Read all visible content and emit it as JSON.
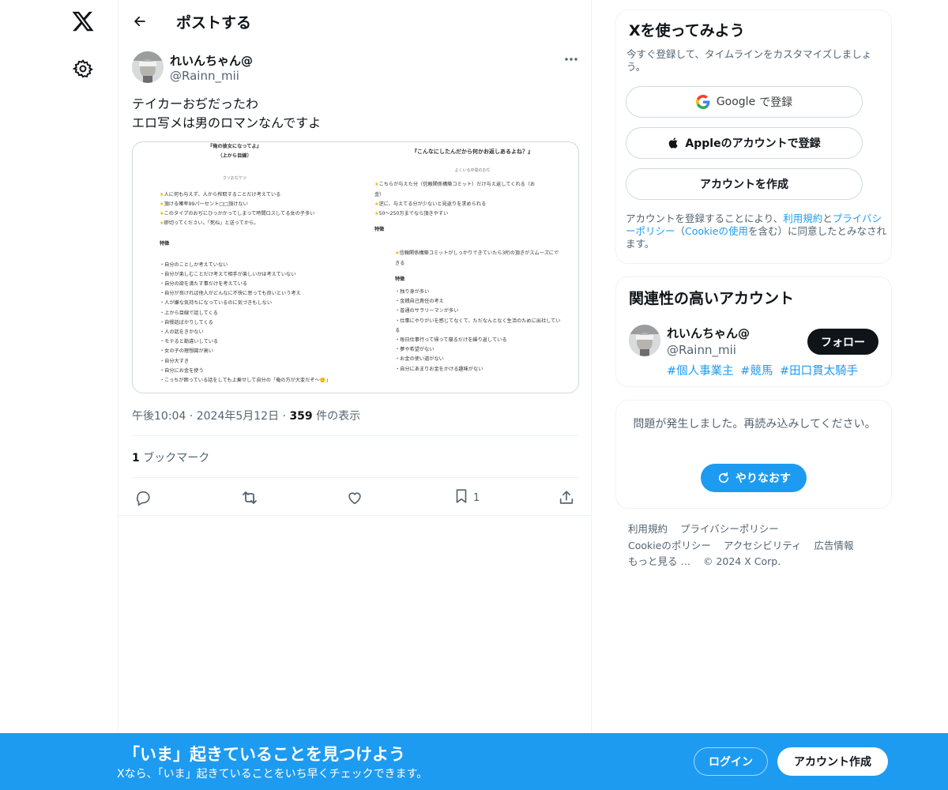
{
  "nav": {
    "logo_icon": "x-logo-icon",
    "settings_icon": "gear-icon"
  },
  "header": {
    "title": "ポストする",
    "back_icon": "arrow-left-icon"
  },
  "tweet": {
    "author_name": "れいんちゃん@",
    "author_handle": "@Rainn_mii",
    "text_lines": [
      "テイカーおぢだったわ",
      "エロ写メは男のロマンなんですよ"
    ],
    "time": "午後10:04",
    "date": "2024年5月12日",
    "views_count": "359",
    "views_label": "件の表示",
    "bookmark_count": "1",
    "bookmark_label": "ブックマーク",
    "actions": {
      "bookmark_count": "1"
    },
    "image": {
      "left_title_1": "『俺の彼女になってよ』",
      "left_title_2": "（上から目線）",
      "left_sub": "クソおぢケツ",
      "left_stars": [
        "人に何も与えず、人から搾取することだけ考えている",
        "頂ける確率99パーセント□□頂けない",
        "このタイプのおぢにひっかかってしまって時間ロスしてる女の子多い",
        "即切ってください。「死ね」と送ってから。"
      ],
      "left_section": "特徴",
      "left_bullets": [
        "・自分のことしか考えていない",
        "・自分が楽しむことだけ考えて相手が楽しいかは考えていない",
        "・自分の欲を満たす事だけを考えている",
        "・自分が良ければ他人がどんなに不快に思っても良いという考え",
        "・人が嫌な気持ちになっているのに気づきもしない",
        "・上から目線で話してくる",
        "・自慢話ばかりしてくる",
        "・人の話をきかない",
        "・モテると勘違いしている",
        "・女の子の理想図が高い",
        "・自分大すき",
        "・自分にお金を使う",
        "・こっちが困っている話をしても上乗せして自分の「俺の方が大変だぞ～🙂」"
      ],
      "right_title": "『こんなにしたんだから何かお返しあるよね？』",
      "right_sub": "よくいる中間のおぢ",
      "right_stars": [
        "こちらが与えた分（信頼関係構築コミット）だけ与え返してくれる（お",
        "金）",
        "逆に、与えてる分が少ないと見返りを求められる",
        "50〜250万までなら頂きやすい"
      ],
      "right_section_1": "特徴",
      "right_star2": "信頼関係構築コミットがしっかりできていたら3桁の頂きがスムーズにで",
      "right_star2b": "きる",
      "right_section_2": "特徴",
      "right_bullets": [
        "・独り身が多い",
        "・金銭自己責任の考え",
        "・普通のサラリーマンが多い",
        "・仕事にやりがいを感じてなくて、ただなんとなく生活のために出社してい",
        "る",
        "・毎日仕事行って帰って寝るだけを繰り返している",
        "・夢や希望がない",
        "・お金の使い道がない",
        "・自分にあまりお金をかける趣味がない"
      ]
    }
  },
  "signup_card": {
    "title": "Xを使ってみよう",
    "subtitle": "今すぐ登録して、タイムラインをカスタマイズしましょう。",
    "google_brand": "Google",
    "google_label": "で登録",
    "apple_label": "Appleのアカウントで登録",
    "create_label": "アカウントを作成",
    "legal_1": "アカウントを登録することにより、",
    "legal_terms": "利用規約",
    "legal_2": "と",
    "legal_privacy": "プライバシーポリシー",
    "legal_3": "（",
    "legal_cookie": "Cookieの使用",
    "legal_4": "を含む）に同意したとみなされます。"
  },
  "related_card": {
    "title": "関連性の高いアカウント",
    "name": "れいんちゃん@",
    "handle": "@Rainn_mii",
    "follow_label": "フォロー",
    "tags": [
      "#個人事業主",
      "#競馬",
      "#田口貫太騎手"
    ]
  },
  "error_card": {
    "message": "問題が発生しました。再読み込みしてください。",
    "retry_label": "やりなおす"
  },
  "footer": {
    "links": [
      "利用規約",
      "プライバシーポリシー",
      "Cookieのポリシー",
      "アクセシビリティ",
      "広告情報",
      "もっと見る …"
    ],
    "copyright": "© 2024 X Corp."
  },
  "banner": {
    "title": "「いま」起きていることを見つけよう",
    "subtitle": "Xなら、「いま」起きていることをいち早くチェックできます。",
    "login_label": "ログイン",
    "signup_label": "アカウント作成"
  },
  "colors": {
    "accent": "#1d9bf0",
    "text": "#0f1419",
    "muted": "#536471",
    "border": "#eff3f4"
  }
}
